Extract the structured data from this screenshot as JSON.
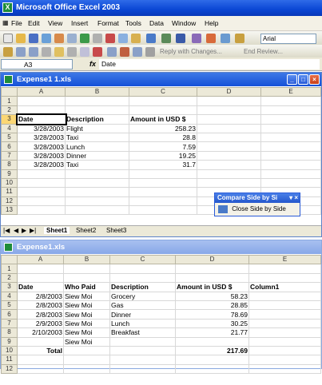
{
  "app": {
    "title": "Microsoft Office Excel 2003"
  },
  "menu": [
    "File",
    "Edit",
    "View",
    "Insert",
    "Format",
    "Tools",
    "Data",
    "Window",
    "Help"
  ],
  "toolbar": {
    "font_name": "Arial",
    "reply_text": "Reply with Changes...",
    "end_review": "End Review..."
  },
  "formula": {
    "cell_ref": "A3",
    "fx": "fx",
    "value": "Date"
  },
  "window1": {
    "title": "Expense1 1.xls",
    "columns": [
      "A",
      "B",
      "C",
      "D",
      "E"
    ],
    "rows": [
      {
        "n": "1",
        "cells": [
          "",
          "",
          "",
          "",
          ""
        ]
      },
      {
        "n": "2",
        "cells": [
          "",
          "",
          "",
          "",
          ""
        ]
      },
      {
        "n": "3",
        "cells": [
          "Date",
          "Description",
          "Amount in USD $",
          "",
          ""
        ]
      },
      {
        "n": "4",
        "cells": [
          "3/28/2003",
          "Flight",
          "258.23",
          "",
          ""
        ]
      },
      {
        "n": "5",
        "cells": [
          "3/28/2003",
          "Taxi",
          "28.8",
          "",
          ""
        ]
      },
      {
        "n": "6",
        "cells": [
          "3/28/2003",
          "Lunch",
          "7.59",
          "",
          ""
        ]
      },
      {
        "n": "7",
        "cells": [
          "3/28/2003",
          "Dinner",
          "19.25",
          "",
          ""
        ]
      },
      {
        "n": "8",
        "cells": [
          "3/28/2003",
          "Taxi",
          "31.7",
          "",
          ""
        ]
      },
      {
        "n": "9",
        "cells": [
          "",
          "",
          "",
          "",
          ""
        ]
      },
      {
        "n": "10",
        "cells": [
          "",
          "",
          "",
          "",
          ""
        ]
      },
      {
        "n": "11",
        "cells": [
          "",
          "",
          "",
          "",
          ""
        ]
      },
      {
        "n": "12",
        "cells": [
          "",
          "",
          "",
          "",
          ""
        ]
      },
      {
        "n": "13",
        "cells": [
          "",
          "",
          "",
          "",
          ""
        ]
      }
    ],
    "tabs": [
      "Sheet1",
      "Sheet2",
      "Sheet3"
    ]
  },
  "compare": {
    "title": "Compare Side by Si",
    "close_label": "Close Side by Side"
  },
  "window2": {
    "title": "Expense1.xls",
    "columns": [
      "A",
      "B",
      "C",
      "D",
      "E"
    ],
    "rows": [
      {
        "n": "1",
        "cells": [
          "",
          "",
          "",
          "",
          ""
        ]
      },
      {
        "n": "2",
        "cells": [
          "",
          "",
          "",
          "",
          ""
        ]
      },
      {
        "n": "3",
        "cells": [
          "Date",
          "Who Paid",
          "Description",
          "Amount in USD $",
          "Column1"
        ]
      },
      {
        "n": "4",
        "cells": [
          "2/8/2003",
          "Siew Moi",
          "Grocery",
          "58.23",
          ""
        ]
      },
      {
        "n": "5",
        "cells": [
          "2/8/2003",
          "Siew Moi",
          "Gas",
          "28.85",
          ""
        ]
      },
      {
        "n": "6",
        "cells": [
          "2/8/2003",
          "Siew Moi",
          "Dinner",
          "78.69",
          ""
        ]
      },
      {
        "n": "7",
        "cells": [
          "2/9/2003",
          "Siew Moi",
          "Lunch",
          "30.25",
          ""
        ]
      },
      {
        "n": "8",
        "cells": [
          "2/10/2003",
          "Siew Moi",
          "Breakfast",
          "21.77",
          ""
        ]
      },
      {
        "n": "9",
        "cells": [
          "",
          "Siew Moi",
          "",
          "",
          ""
        ]
      },
      {
        "n": "10",
        "cells": [
          "Total",
          "",
          "",
          "217.69",
          ""
        ]
      },
      {
        "n": "11",
        "cells": [
          "",
          "",
          "",
          "",
          ""
        ]
      },
      {
        "n": "12",
        "cells": [
          "",
          "",
          "",
          "",
          ""
        ]
      }
    ]
  }
}
